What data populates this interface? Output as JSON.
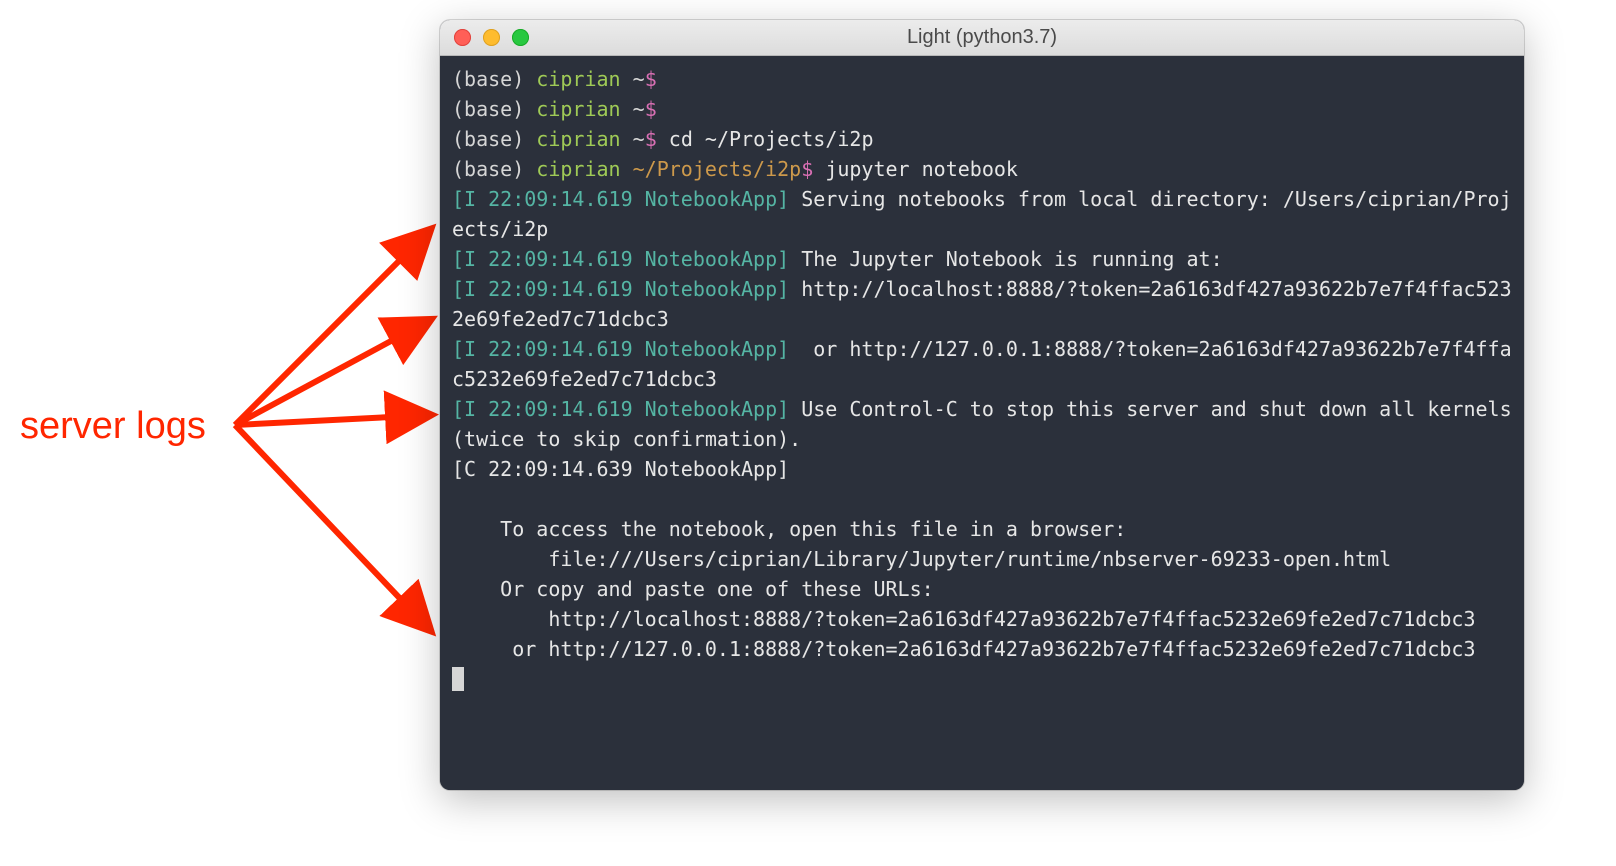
{
  "annotation": {
    "label": "server logs"
  },
  "titlebar": {
    "title": "Light (python3.7)"
  },
  "prompt": {
    "base_open": "(base) ",
    "user": "ciprian",
    "home_sep": " ~",
    "dollar": "$",
    "path_sep": " ~/Projects/i2p",
    "cmd_cd": "cd ~/Projects/i2p",
    "cmd_jupyter": "jupyter notebook"
  },
  "log": {
    "info_prefix": "[I 22:09:14.619 NotebookApp]",
    "crit_prefix": "[C 22:09:14.639 NotebookApp]",
    "l1": " Serving notebooks from local directory: /Users/ciprian/Projects/i2p",
    "l2": " The Jupyter Notebook is running at:",
    "l3": " http://localhost:8888/?token=2a6163df427a93622b7e7f4ffac5232e69fe2ed7c71dcbc3",
    "l4": "  or http://127.0.0.1:8888/?token=2a6163df427a93622b7e7f4ffac5232e69fe2ed7c71dcbc3",
    "l5": " Use Control-C to stop this server and shut down all kernels (twice to skip confirmation).",
    "l6_a": "    To access the notebook, open this file in a browser:",
    "l6_b": "        file:///Users/ciprian/Library/Jupyter/runtime/nbserver-69233-open.html",
    "l6_c": "    Or copy and paste one of these URLs:",
    "l6_d": "        http://localhost:8888/?token=2a6163df427a93622b7e7f4ffac5232e69fe2ed7c71dcbc3",
    "l6_e": "     or http://127.0.0.1:8888/?token=2a6163df427a93622b7e7f4ffac5232e69fe2ed7c71dcbc3"
  }
}
